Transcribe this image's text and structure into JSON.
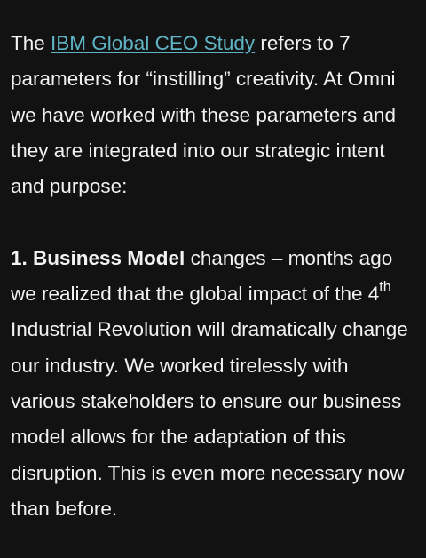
{
  "article": {
    "paragraph_1": {
      "prefix": "The ",
      "link_text": "IBM Global CEO Study",
      "suffix": " refers to 7 parameters for “instilling” creativity. At Omni we have worked with these parameters and they are integrated into our strategic intent and purpose:"
    },
    "paragraph_2": {
      "bold_lead": "1. Business Model",
      "text_before_sup": " changes – months ago we realized that the global impact of the 4",
      "superscript": "th",
      "text_after_sup": " Industrial Revolution will dramatically change our industry. We worked tirelessly with various stakeholders to ensure our business model allows for the adaptation of this disruption. This is even more necessary now than before."
    }
  },
  "colors": {
    "background": "#121212",
    "text": "#f2f2f2",
    "link": "#5fb3c4"
  }
}
